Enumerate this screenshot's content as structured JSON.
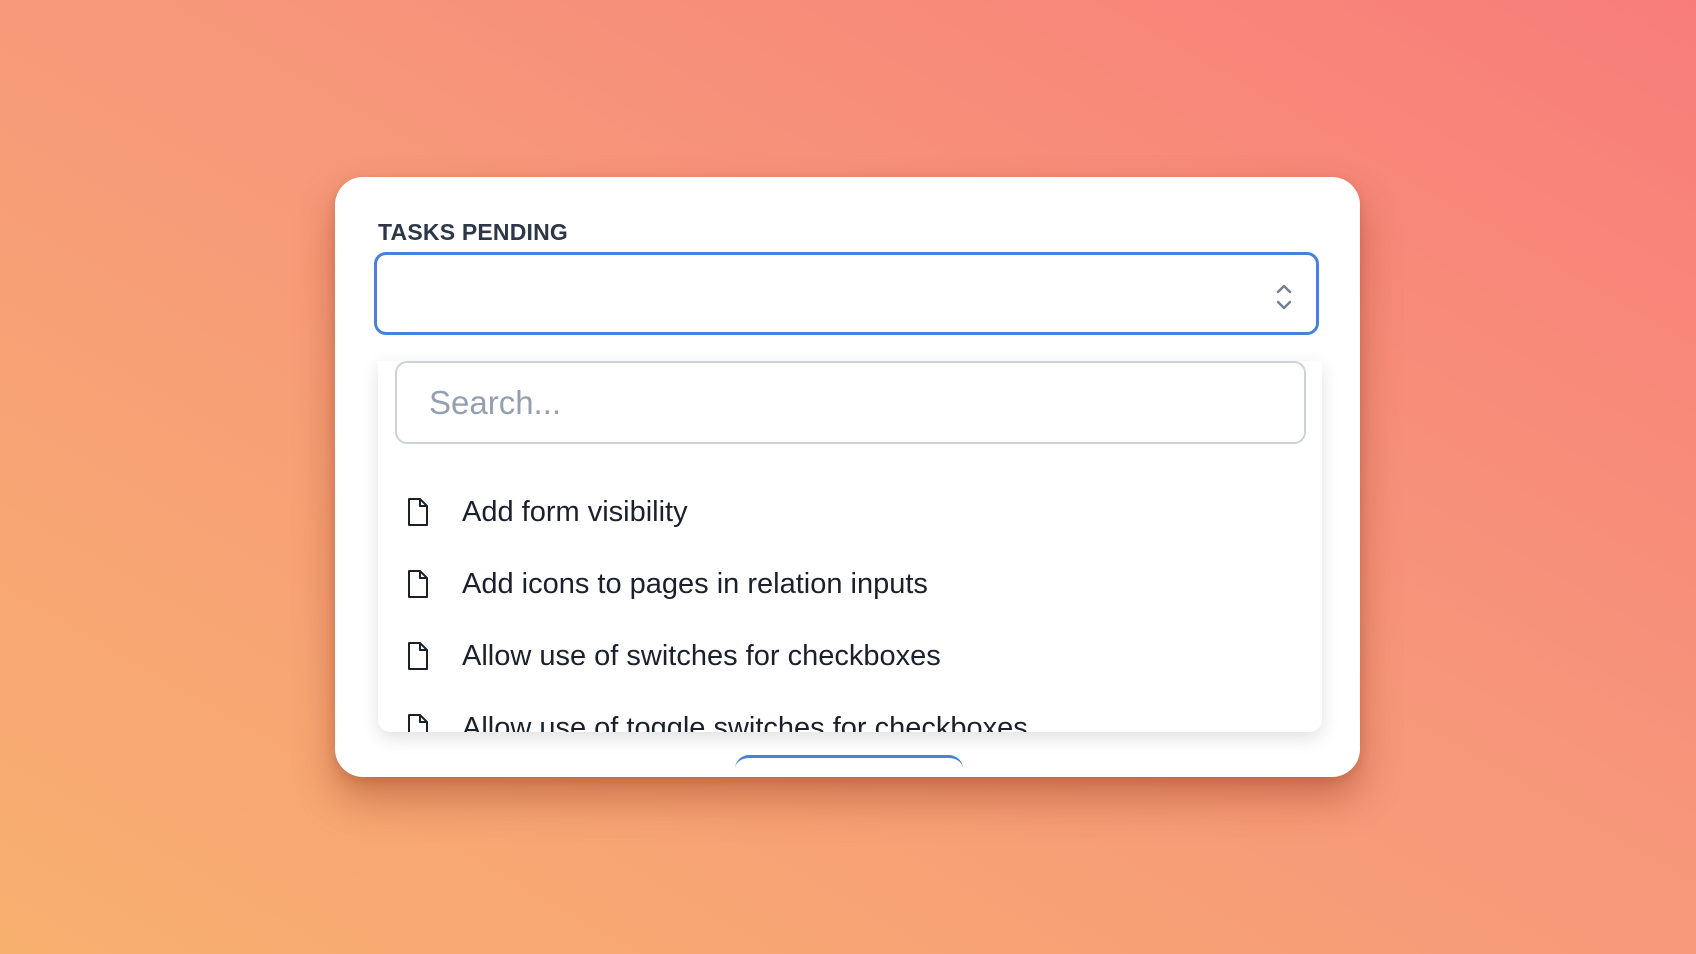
{
  "field": {
    "label": "TASKS PENDING",
    "value": ""
  },
  "dropdown": {
    "search_placeholder": "Search...",
    "options": [
      {
        "label": "Add form visibility",
        "icon": "document-icon"
      },
      {
        "label": "Add icons to pages in relation inputs",
        "icon": "document-icon"
      },
      {
        "label": "Allow use of switches for checkboxes",
        "icon": "document-icon"
      },
      {
        "label": "Allow use of toggle switches for checkboxes",
        "icon": "document-icon"
      }
    ]
  },
  "colors": {
    "focus_border": "#4a80d9",
    "label_text": "#2d3748",
    "option_text": "#1a202c",
    "placeholder": "#94a0b2"
  }
}
